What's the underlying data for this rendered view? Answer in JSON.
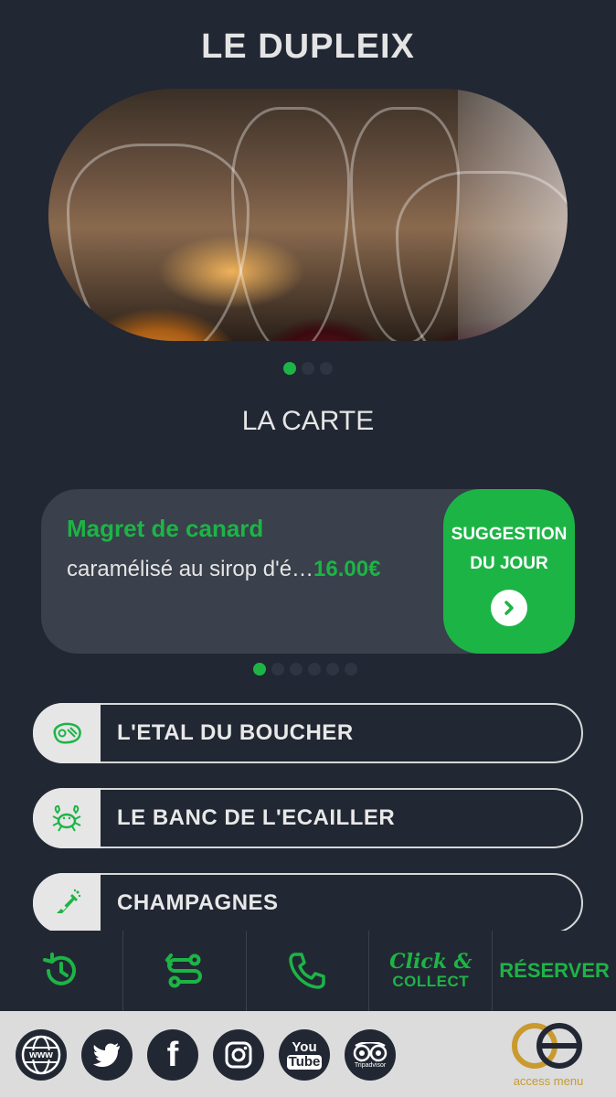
{
  "restaurant": {
    "name": "LE DUPLEIX"
  },
  "hero": {
    "slide_count": 3,
    "active_index": 0
  },
  "menu": {
    "section_title": "LA CARTE"
  },
  "suggestion": {
    "name": "Magret de canard",
    "description": "caramélisé au sirop d'é…",
    "price": "16.00€",
    "badge_line1": "SUGGESTION",
    "badge_line2": "DU JOUR",
    "slide_count": 6,
    "active_index": 0
  },
  "categories": [
    {
      "label": "L'ETAL DU BOUCHER",
      "icon": "steak-icon"
    },
    {
      "label": "LE BANC DE L'ECAILLER",
      "icon": "crab-icon"
    },
    {
      "label": "CHAMPAGNES",
      "icon": "champagne-bottle-icon"
    }
  ],
  "navbar": {
    "history_icon": "history-clock-icon",
    "route_icon": "route-icon",
    "phone_icon": "phone-icon",
    "click_collect_top": "Click &",
    "click_collect_bottom": "COLLECT",
    "reserve": "RÉSERVER"
  },
  "footer": {
    "social": [
      {
        "name": "website-icon",
        "label": "www"
      },
      {
        "name": "twitter-icon"
      },
      {
        "name": "facebook-icon",
        "label": "f"
      },
      {
        "name": "instagram-icon"
      },
      {
        "name": "youtube-icon",
        "label_top": "You",
        "label_bottom": "Tube"
      },
      {
        "name": "tripadvisor-icon",
        "label": "Tripadvisor"
      }
    ],
    "brand": "access menu"
  },
  "colors": {
    "accent": "#1db446",
    "background": "#212733",
    "card": "#3a404c",
    "footer": "#dcdcdc",
    "brand_gold": "#c99a2e"
  }
}
